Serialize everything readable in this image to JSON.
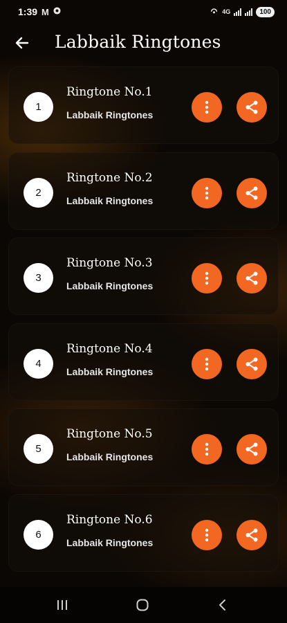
{
  "status_bar": {
    "time": "1:39",
    "gmail_icon": "M",
    "battery": "100",
    "network": "4G"
  },
  "app_bar": {
    "title": "Labbaik Ringtones"
  },
  "ringtones": [
    {
      "number": "1",
      "title": "Ringtone No.1",
      "subtitle": "Labbaik Ringtones"
    },
    {
      "number": "2",
      "title": "Ringtone No.2",
      "subtitle": "Labbaik Ringtones"
    },
    {
      "number": "3",
      "title": "Ringtone No.3",
      "subtitle": "Labbaik Ringtones"
    },
    {
      "number": "4",
      "title": "Ringtone No.4",
      "subtitle": "Labbaik Ringtones"
    },
    {
      "number": "5",
      "title": "Ringtone No.5",
      "subtitle": "Labbaik Ringtones"
    },
    {
      "number": "6",
      "title": "Ringtone No.6",
      "subtitle": "Labbaik Ringtones"
    }
  ],
  "colors": {
    "accent": "#f26722",
    "background": "#0b0704"
  }
}
